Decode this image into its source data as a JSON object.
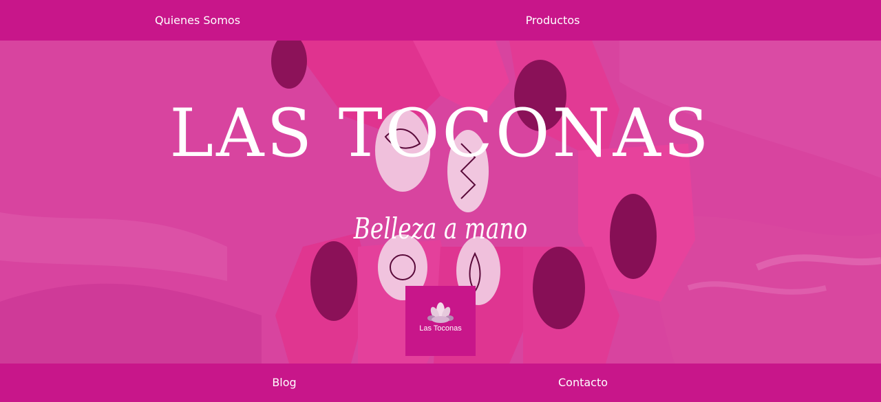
{
  "nav": {
    "top": [
      "Quienes Somos",
      "Productos"
    ],
    "bottom": [
      "Blog",
      "Contacto"
    ]
  },
  "hero": {
    "title": "LAS TOCONAS",
    "subtitle": "Belleza a mano"
  },
  "logo": {
    "text": "Las Toconas",
    "icon": "lotus-icon"
  },
  "colors": {
    "brand": "#c8168a",
    "overlay": "#d63d9f",
    "text": "#ffffff"
  }
}
